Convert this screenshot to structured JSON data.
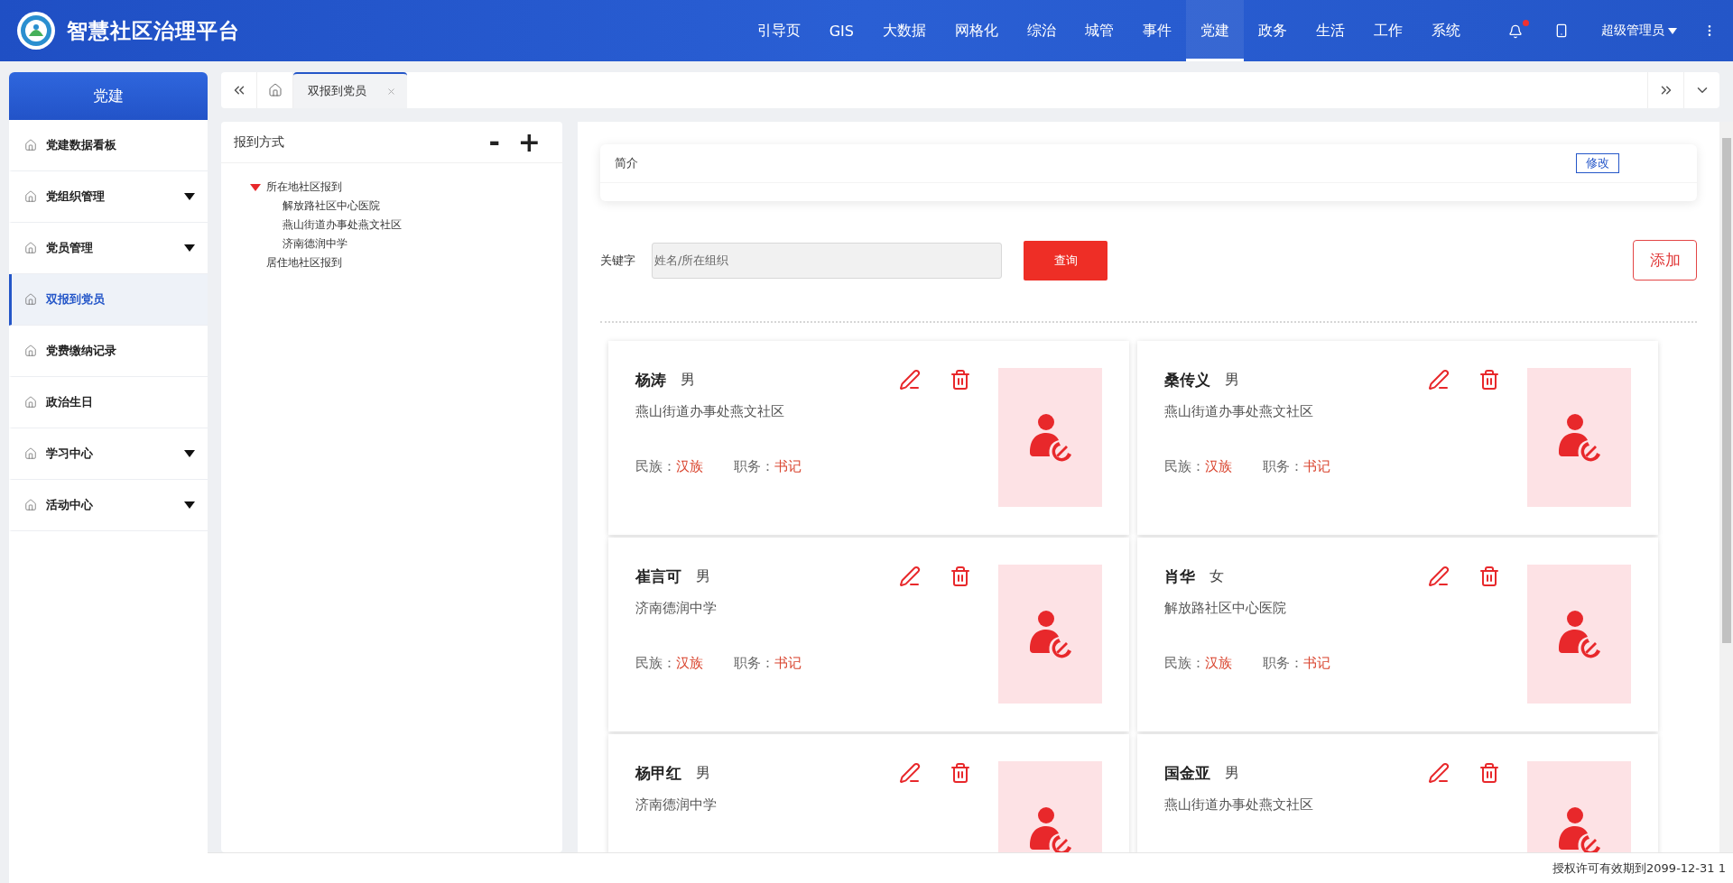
{
  "app": {
    "title": "智慧社区治理平台"
  },
  "nav": [
    {
      "label": "引导页",
      "selected": false
    },
    {
      "label": "GIS",
      "selected": false
    },
    {
      "label": "大数据",
      "selected": false
    },
    {
      "label": "网格化",
      "selected": false
    },
    {
      "label": "综治",
      "selected": false
    },
    {
      "label": "城管",
      "selected": false
    },
    {
      "label": "事件",
      "selected": false
    },
    {
      "label": "党建",
      "selected": true
    },
    {
      "label": "政务",
      "selected": false
    },
    {
      "label": "生活",
      "selected": false
    },
    {
      "label": "工作",
      "selected": false
    },
    {
      "label": "系统",
      "selected": false
    }
  ],
  "user": {
    "name": "超级管理员",
    "notification": true
  },
  "sidebar": {
    "title": "党建",
    "items": [
      {
        "label": "党建数据看板",
        "selected": false,
        "expandable": false
      },
      {
        "label": "党组织管理",
        "selected": false,
        "expandable": true
      },
      {
        "label": "党员管理",
        "selected": false,
        "expandable": true
      },
      {
        "label": "双报到党员",
        "selected": true,
        "expandable": false
      },
      {
        "label": "党费缴纳记录",
        "selected": false,
        "expandable": false
      },
      {
        "label": "政治生日",
        "selected": false,
        "expandable": false
      },
      {
        "label": "学习中心",
        "selected": false,
        "expandable": true
      },
      {
        "label": "活动中心",
        "selected": false,
        "expandable": true
      }
    ]
  },
  "tabs": [
    {
      "label": "双报到党员",
      "selected": true
    }
  ],
  "tree": {
    "title": "报到方式",
    "collapse": "-",
    "expand": "+",
    "nodes": [
      {
        "label": "所在地社区报到",
        "expanded": true,
        "children": [
          {
            "label": "解放路社区中心医院"
          },
          {
            "label": "燕山街道办事处燕文社区"
          },
          {
            "label": "济南德润中学"
          }
        ]
      },
      {
        "label": "居住地社区报到"
      }
    ]
  },
  "intro": {
    "label": "简介",
    "edit": "修改"
  },
  "search": {
    "label": "关键字",
    "placeholder": "姓名/所在组织",
    "button": "查询",
    "add": "添加"
  },
  "members": [
    {
      "name": "杨涛",
      "gender": "男",
      "org": "燕山街道办事处燕文社区",
      "ethnicity_label": "民族：",
      "ethnicity": "汉族",
      "position_label": "职务：",
      "position": "书记"
    },
    {
      "name": "桑传义",
      "gender": "男",
      "org": "燕山街道办事处燕文社区",
      "ethnicity_label": "民族：",
      "ethnicity": "汉族",
      "position_label": "职务：",
      "position": "书记"
    },
    {
      "name": "崔言可",
      "gender": "男",
      "org": "济南德润中学",
      "ethnicity_label": "民族：",
      "ethnicity": "汉族",
      "position_label": "职务：",
      "position": "书记"
    },
    {
      "name": "肖华",
      "gender": "女",
      "org": "解放路社区中心医院",
      "ethnicity_label": "民族：",
      "ethnicity": "汉族",
      "position_label": "职务：",
      "position": "书记"
    },
    {
      "name": "杨甲红",
      "gender": "男",
      "org": "济南德润中学"
    },
    {
      "name": "国金亚",
      "gender": "男",
      "org": "燕山街道办事处燕文社区"
    }
  ],
  "footer": "授权许可有效期到2099-12-31 1"
}
